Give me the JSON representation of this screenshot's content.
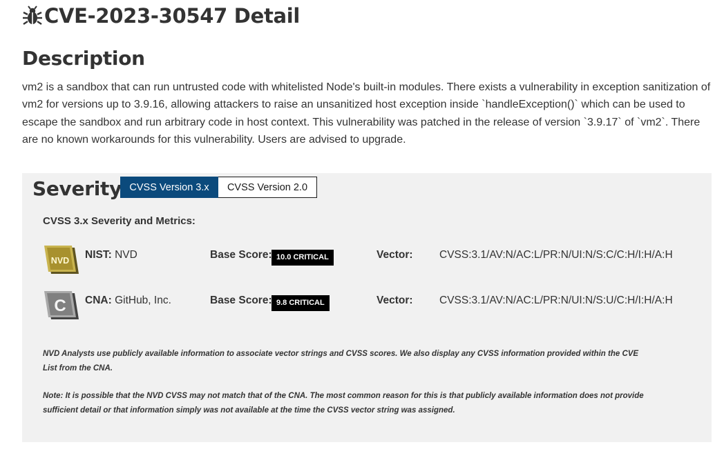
{
  "title": "CVE-2023-30547 Detail",
  "description": {
    "heading": "Description",
    "text": "vm2 is a sandbox that can run untrusted code with whitelisted Node's built-in modules. There exists a vulnerability in exception sanitization of vm2 for versions up to 3.9.16, allowing attackers to raise an unsanitized host exception inside `handleException()` which can be used to escape the sandbox and run arbitrary code in host context. This vulnerability was patched in the release of version `3.9.17` of `vm2`. There are no known workarounds for this vulnerability. Users are advised to upgrade."
  },
  "severity": {
    "heading": "Severity",
    "tabs": [
      "CVSS Version 3.x",
      "CVSS Version 2.0"
    ],
    "active_tab": "CVSS Version 3.x",
    "metrics_heading": "CVSS 3.x Severity and Metrics:",
    "rows": [
      {
        "badge_text": "NVD",
        "source_label": "NIST:",
        "source_value": "NVD",
        "base_score_label": "Base Score:",
        "base_score": "10.0 CRITICAL",
        "vector_label": "Vector:",
        "vector": "CVSS:3.1/AV:N/AC:L/PR:N/UI:N/S:C/C:H/I:H/A:H"
      },
      {
        "badge_text": "C",
        "source_label": "CNA:",
        "source_value": "GitHub, Inc.",
        "base_score_label": "Base Score:",
        "base_score": "9.8 CRITICAL",
        "vector_label": "Vector:",
        "vector": "CVSS:3.1/AV:N/AC:L/PR:N/UI:N/S:U/C:H/I:H/A:H"
      }
    ],
    "notes": [
      "NVD Analysts use publicly available information to associate vector strings and CVSS scores. We also display any CVSS information provided within the CVE List from the CNA.",
      "Note: It is possible that the NVD CVSS may not match that of the CNA. The most common reason for this is that publicly available information does not provide sufficient detail or that information simply was not available at the time the CVSS vector string was assigned."
    ]
  },
  "icons": {
    "title_icon": "bug-icon",
    "nist_badge": "nvd-badge-icon",
    "cna_badge": "cna-badge-icon"
  },
  "colors": {
    "active_tab": "#0b4a7c",
    "panel_bg": "#f1f1f1",
    "severity_badge": "#000000",
    "nvd_badge": "#b5a03b",
    "cna_badge": "#8a8a8a"
  }
}
